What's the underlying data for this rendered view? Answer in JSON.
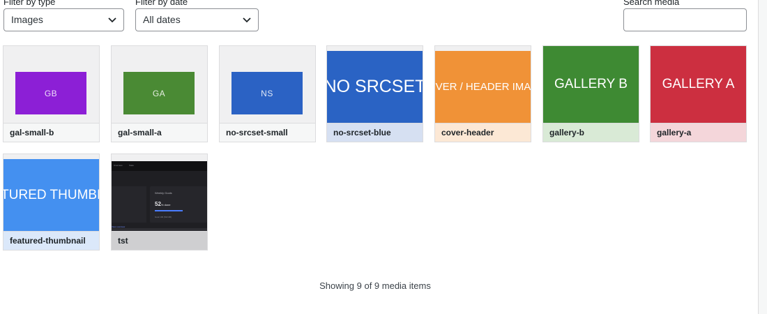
{
  "filters": {
    "type_label": "Filter by type",
    "type_value": "Images",
    "date_label": "Filter by date",
    "date_value": "All dates",
    "search_label": "Search media",
    "search_value": ""
  },
  "media": [
    {
      "caption": "gal-small-b",
      "thumb_text": "GB",
      "color": "#8c1fd6",
      "style": "inner"
    },
    {
      "caption": "gal-small-a",
      "thumb_text": "GA",
      "color": "#4a8a34",
      "style": "inner"
    },
    {
      "caption": "no-srcset-small",
      "thumb_text": "NS",
      "color": "#2b62c4",
      "style": "inner"
    },
    {
      "caption": "no-srcset-blue",
      "thumb_text": "NO SRCSET",
      "color": "#2a63c4",
      "style": "band",
      "caption_bg": "#d6e0f2"
    },
    {
      "caption": "cover-header",
      "thumb_text": "COVER / HEADER IMAGE",
      "color": "#f09237",
      "style": "band",
      "caption_bg": "#fce8d5"
    },
    {
      "caption": "gallery-b",
      "thumb_text": "GALLERY B",
      "color": "#3e8a33",
      "style": "band",
      "caption_bg": "#d9ead6"
    },
    {
      "caption": "gallery-a",
      "thumb_text": "GALLERY A",
      "color": "#cc2f40",
      "style": "band",
      "caption_bg": "#f4d6da"
    },
    {
      "caption": "featured-thumbnail",
      "thumb_text": "FEATURED THUMBNAIL",
      "color": "#4490f0",
      "style": "band",
      "caption_bg": "#dbe8fa"
    },
    {
      "caption": "tst",
      "style": "screenshot",
      "caption_bg": "#cfcfd1",
      "shot": {
        "tab1": "Overview",
        "tab2": "Stats",
        "card_title": "Weekly Goals",
        "card_value": "52",
        "card_unit": "% done",
        "note": "Goal 100 (52/100)",
        "link": "View overview"
      }
    }
  ],
  "status_text": "Showing 9 of 9 media items",
  "icons": {
    "select_chevron": "chevron-down-icon"
  }
}
